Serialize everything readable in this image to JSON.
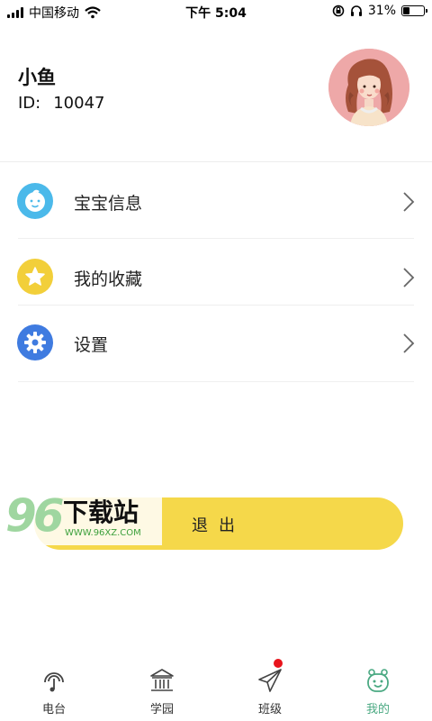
{
  "status_bar": {
    "carrier": "中国移动",
    "time": "下午 5:04",
    "battery": "31%",
    "battery_level": 0.31
  },
  "profile": {
    "name": "小鱼",
    "id_label": "ID:",
    "id_value": "10047",
    "avatar_icon": "girl-avatar-icon"
  },
  "menu": {
    "items": [
      {
        "label": "宝宝信息",
        "icon": "baby-icon",
        "color": "#4bb9ea"
      },
      {
        "label": "我的收藏",
        "icon": "star-icon",
        "color": "#f2cf3a"
      },
      {
        "label": "设置",
        "icon": "gear-icon",
        "color": "#3f7be0"
      }
    ]
  },
  "logout_label": "退出",
  "watermark": {
    "number": "96",
    "text": "下载站",
    "url": "WWW.96XZ.COM"
  },
  "tabbar": {
    "items": [
      {
        "label": "电台",
        "icon": "radio-icon"
      },
      {
        "label": "学园",
        "icon": "school-icon"
      },
      {
        "label": "班级",
        "icon": "paper-plane-icon",
        "badge": true
      },
      {
        "label": "我的",
        "icon": "smiley-icon",
        "active": true
      }
    ],
    "active_color": "#4aa982"
  }
}
